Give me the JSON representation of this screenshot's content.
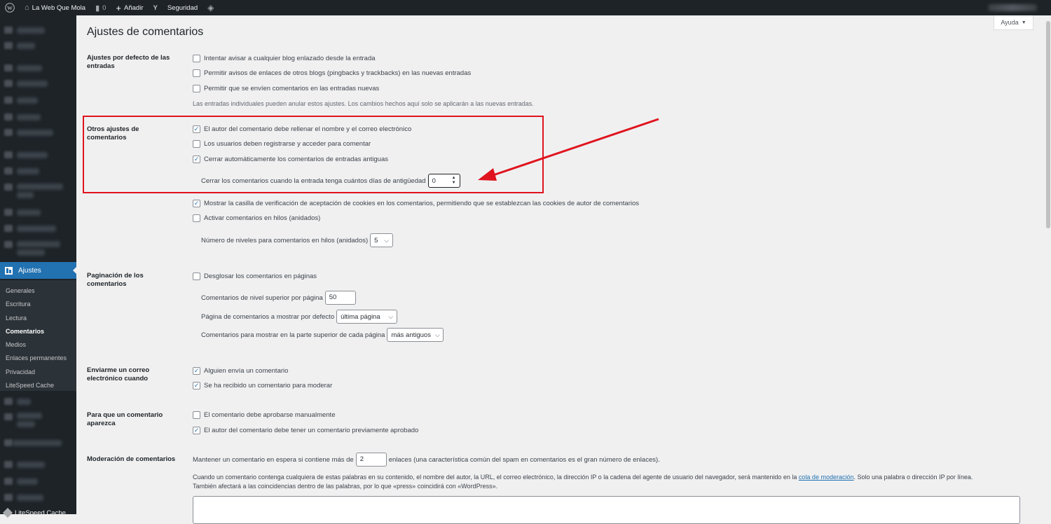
{
  "adminbar": {
    "site_name": "La Web Que Mola",
    "comments_count": "0",
    "add_new": "Añadir",
    "security": "Seguridad"
  },
  "sidebar": {
    "settings_label": "Ajustes",
    "submenu": [
      "Generales",
      "Escritura",
      "Lectura",
      "Comentarios",
      "Medios",
      "Enlaces permanentes",
      "Privacidad",
      "LiteSpeed Cache"
    ],
    "bottom_label": "LiteSpeed Cache"
  },
  "header": {
    "title": "Ajustes de comentarios",
    "help": "Ayuda"
  },
  "sections": {
    "defaults": {
      "label": "Ajustes por defecto de las entradas",
      "options": [
        {
          "text": "Intentar avisar a cualquier blog enlazado desde la entrada",
          "checked": false
        },
        {
          "text": "Permitir avisos de enlaces de otros blogs (pingbacks y trackbacks) en las nuevas entradas",
          "checked": false
        },
        {
          "text": "Permitir que se envíen comentarios en las entradas nuevas",
          "checked": false
        }
      ],
      "description": "Las entradas individuales pueden anular estos ajustes. Los cambios hechos aquí solo se aplicarán a las nuevas entradas."
    },
    "other": {
      "label": "Otros ajustes de comentarios",
      "options": [
        {
          "text": "El autor del comentario debe rellenar el nombre y el correo electrónico",
          "checked": true
        },
        {
          "text": "Los usuarios deben registrarse y acceder para comentar",
          "checked": false
        },
        {
          "text": "Cerrar automáticamente los comentarios de entradas antiguas",
          "checked": true
        }
      ],
      "close_days_label": "Cerrar los comentarios cuando la entrada tenga cuántos días de antigüedad",
      "close_days_value": "0",
      "cookies_option": {
        "text": "Mostrar la casilla de verificación de aceptación de cookies en los comentarios, permitiendo que se establezcan las cookies de autor de comentarios",
        "checked": true
      },
      "threaded_option": {
        "text": "Activar comentarios en hilos (anidados)",
        "checked": false
      },
      "thread_levels_label": "Número de niveles para comentarios en hilos (anidados)",
      "thread_levels_value": "5"
    },
    "pagination": {
      "label": "Paginación de los comentarios",
      "option": {
        "text": "Desglosar los comentarios en páginas",
        "checked": false
      },
      "per_page_label": "Comentarios de nivel superior por página",
      "per_page_value": "50",
      "default_page_label": "Página de comentarios a mostrar por defecto",
      "default_page_value": "última página",
      "order_label": "Comentarios para mostrar en la parte superior de cada página",
      "order_value": "más antiguos"
    },
    "email": {
      "label": "Enviarme un correo electrónico cuando",
      "options": [
        {
          "text": "Alguien envía un comentario",
          "checked": true
        },
        {
          "text": "Se ha recibido un comentario para moderar",
          "checked": true
        }
      ]
    },
    "appear": {
      "label": "Para que un comentario aparezca",
      "options": [
        {
          "text": "El comentario debe aprobarse manualmente",
          "checked": false
        },
        {
          "text": "El autor del comentario debe tener un comentario previamente aprobado",
          "checked": true
        }
      ]
    },
    "moderation": {
      "label": "Moderación de comentarios",
      "hold_prefix": "Mantener un comentario en espera si contiene más de",
      "hold_value": "2",
      "hold_suffix": "enlaces (una característica común del spam en comentarios es el gran número de enlaces).",
      "desc_line1_a": "Cuando un comentario contenga cualquiera de estas palabras en su contenido, el nombre del autor, la URL, el correo electrónico, la dirección IP o la cadena del agente de usuario del navegador, será mantenido en la",
      "desc_link": "cola de moderación",
      "desc_line1_b": ". Solo una palabra o dirección IP por línea.",
      "desc_line2": "También afectará a las coincidencias dentro de las palabras, por lo que «press» coincidirá con «WordPress»."
    }
  },
  "colors": {
    "accent": "#2271b1",
    "highlight_box": "#e0141e"
  }
}
